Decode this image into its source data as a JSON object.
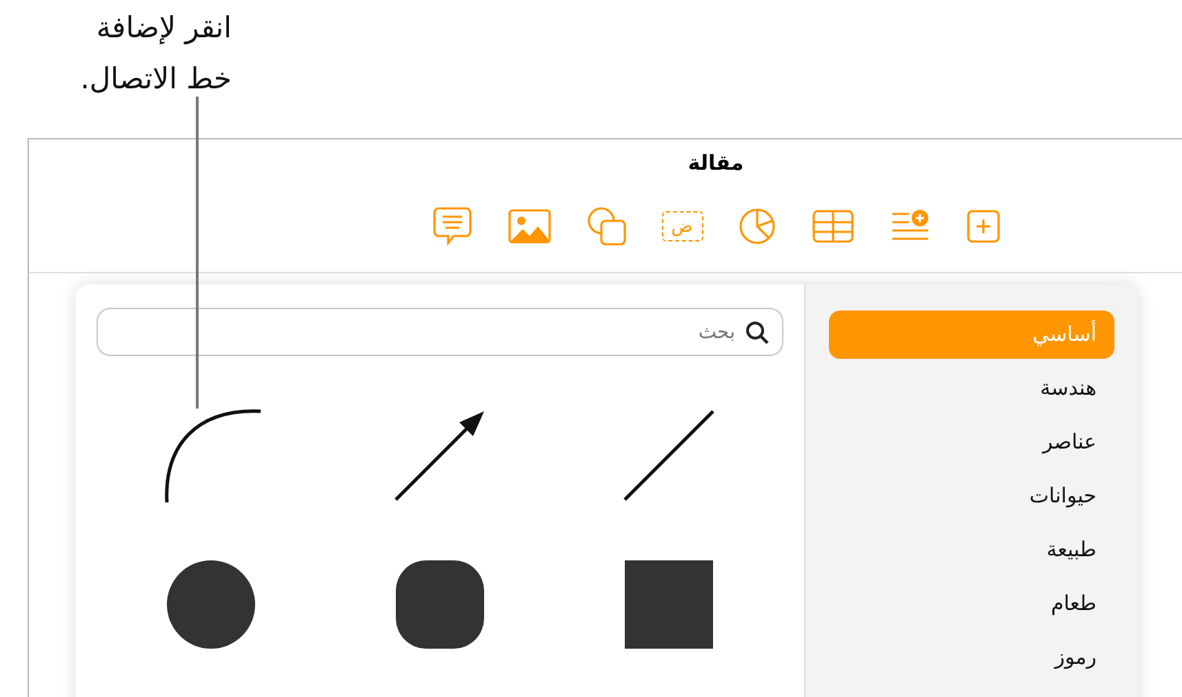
{
  "callout": {
    "lines": [
      "انقر لإضافة",
      "خط الاتصال."
    ]
  },
  "window": {
    "title": "مقالة"
  },
  "toolbar": [
    {
      "kind": "add"
    },
    {
      "kind": "list-add"
    },
    {
      "kind": "table"
    },
    {
      "kind": "chart"
    },
    {
      "kind": "text",
      "glyph": "ض"
    },
    {
      "kind": "shape"
    },
    {
      "kind": "media"
    },
    {
      "kind": "comment"
    }
  ],
  "shapes_popover": {
    "search": {
      "placeholder": "بحث"
    },
    "categories": [
      {
        "label": "أساسي",
        "selected": true
      },
      {
        "label": "هندسة",
        "selected": false
      },
      {
        "label": "عناصر",
        "selected": false
      },
      {
        "label": "حيوانات",
        "selected": false
      },
      {
        "label": "طبيعة",
        "selected": false
      },
      {
        "label": "طعام",
        "selected": false
      },
      {
        "label": "رموز",
        "selected": false
      }
    ],
    "shapes": [
      {
        "kind": "line"
      },
      {
        "kind": "arrow"
      },
      {
        "kind": "curve"
      },
      {
        "kind": "square"
      },
      {
        "kind": "rounded-square"
      },
      {
        "kind": "circle"
      }
    ]
  }
}
